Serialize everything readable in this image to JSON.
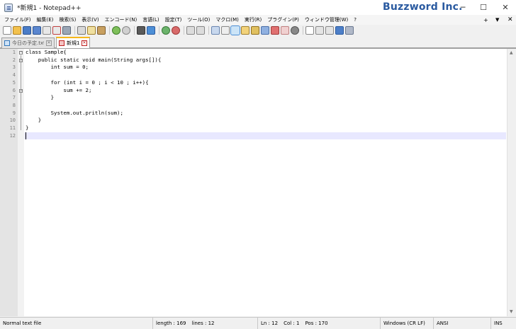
{
  "window": {
    "title": "*新規1 - Notepad++",
    "brand": "Buzzword Inc.",
    "minimize_glyph": "─",
    "maximize_glyph": "☐",
    "close_glyph": "✕"
  },
  "menu": {
    "items": [
      "ファイル(F)",
      "編集(E)",
      "検索(S)",
      "表示(V)",
      "エンコード(N)",
      "言語(L)",
      "設定(T)",
      "ツール(O)",
      "マクロ(M)",
      "実行(R)",
      "プラグイン(P)",
      "ウィンドウ管理(W)",
      "?"
    ],
    "right": {
      "plus": "+",
      "dropdown": "▼",
      "close": "✕"
    }
  },
  "toolbar": {
    "buttons": [
      "new-file-icon",
      "open-file-icon",
      "save-icon",
      "save-all-icon",
      "close-icon",
      "close-all-icon",
      "print-icon",
      "cut-icon",
      "copy-icon",
      "paste-icon",
      "undo-icon",
      "redo-icon",
      "find-icon",
      "replace-icon",
      "zoom-in-icon",
      "zoom-out-icon",
      "sync-vertical-icon",
      "sync-horizontal-icon",
      "word-wrap-icon",
      "show-all-characters-icon",
      "indent-guide-icon",
      "udl-icon",
      "doc-map-icon",
      "function-list-icon",
      "folder-workspace-icon",
      "monitoring-icon",
      "record-macro-icon",
      "stop-recording-icon",
      "playback-macro-icon",
      "run-macro-multiple-icon",
      "save-macro-icon"
    ]
  },
  "tabs": [
    {
      "label": "今日の予定.txt",
      "active": false
    },
    {
      "label": "新規1",
      "active": true
    }
  ],
  "editor": {
    "lines": [
      "class Sample{",
      "    public static void main(String args[]){",
      "        int sum = 0;",
      "",
      "        for (int i = 0 ; i < 10 ; i++){",
      "            sum += 2;",
      "        }",
      "",
      "        System.out.pritln(sum);",
      "    }",
      "}",
      ""
    ],
    "line_numbers": [
      "1",
      "2",
      "3",
      "4",
      "5",
      "6",
      "7",
      "8",
      "9",
      "10",
      "11",
      "12"
    ],
    "current_line": 12,
    "scroll_up": "▲",
    "scroll_down": "▼"
  },
  "status": {
    "file_type": "Normal text file",
    "length": "length : 169",
    "lines": "lines : 12",
    "ln": "Ln : 12",
    "col": "Col : 1",
    "pos": "Pos : 170",
    "eol": "Windows (CR LF)",
    "encoding": "ANSI",
    "mode": "INS"
  },
  "colors": {
    "brand": "#2a5aa0",
    "current_line": "#e8e8ff",
    "active_tab_accent": "#f6b71b"
  }
}
